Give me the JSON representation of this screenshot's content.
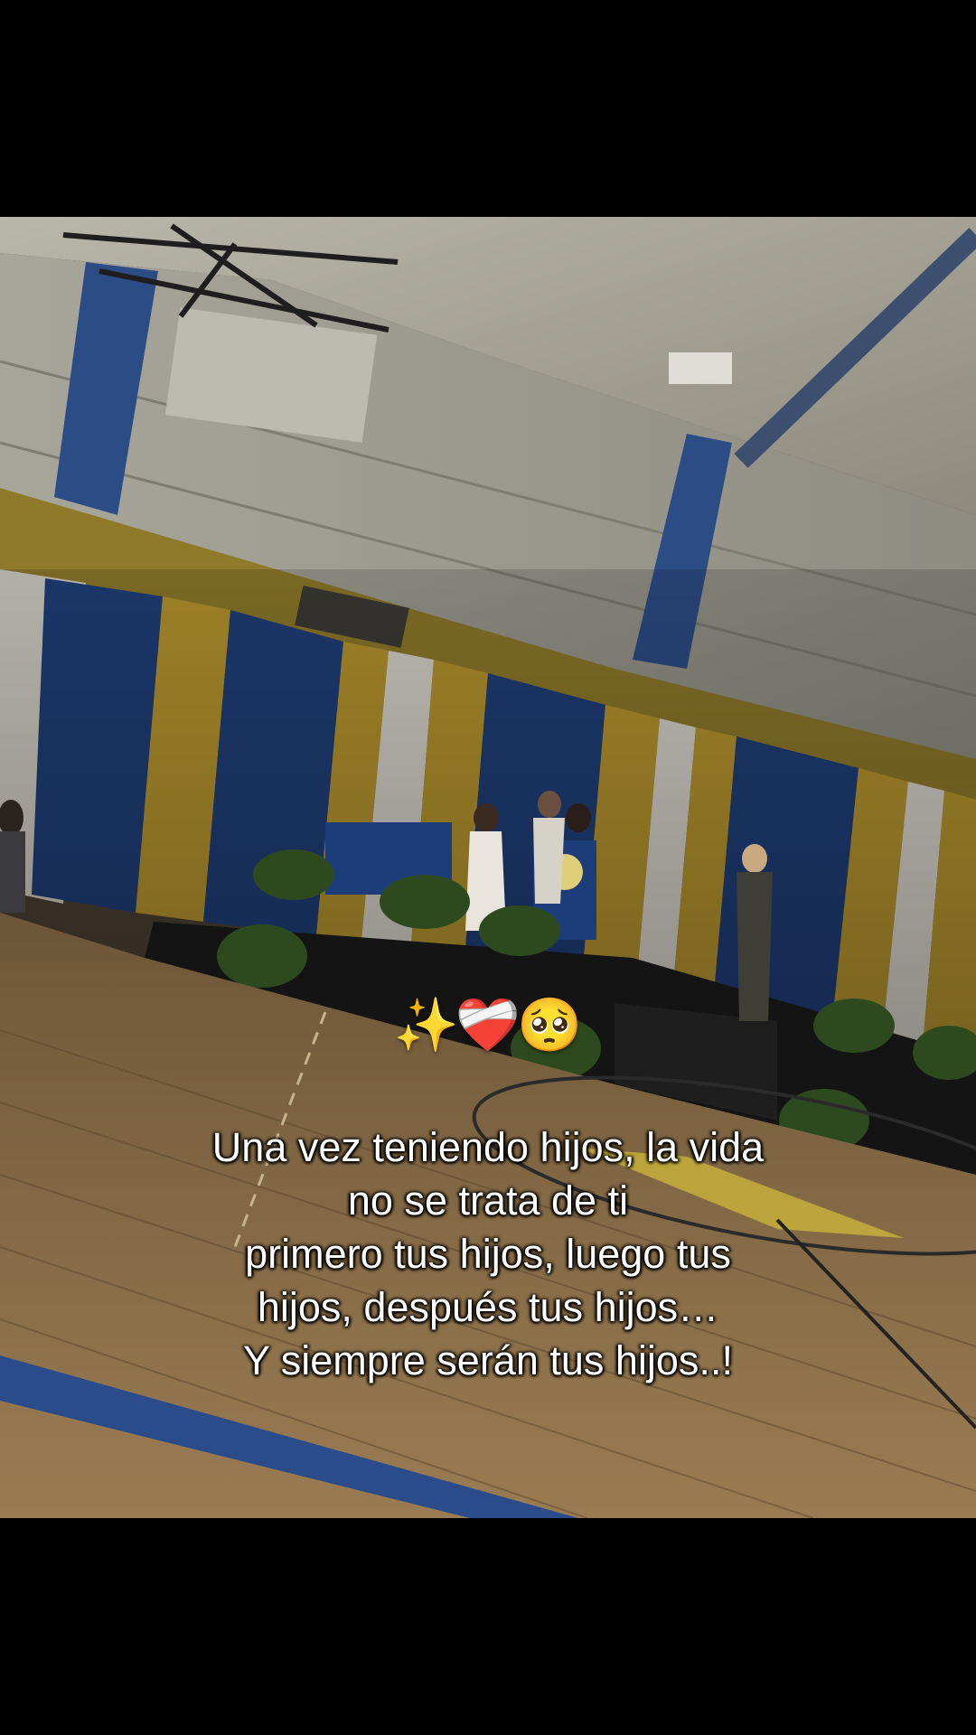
{
  "scene": {
    "emojis": [
      "✨",
      "❤️‍🩹",
      "🥺"
    ],
    "caption_lines": [
      "Una vez teniendo hijos, la vida",
      "no se trata de ti",
      "primero tus hijos, luego tus",
      "hijos, después tus hijos…",
      "Y siempre serán tus hijos..!"
    ]
  },
  "colors": {
    "background": "#000000",
    "curtain_blue": "#1f3f7a",
    "curtain_gold": "#b8962e",
    "curtain_white": "#d9d6cc",
    "floor": "#8a6d45",
    "wall": "#c9c6b6",
    "caption_text": "#ffffff"
  }
}
